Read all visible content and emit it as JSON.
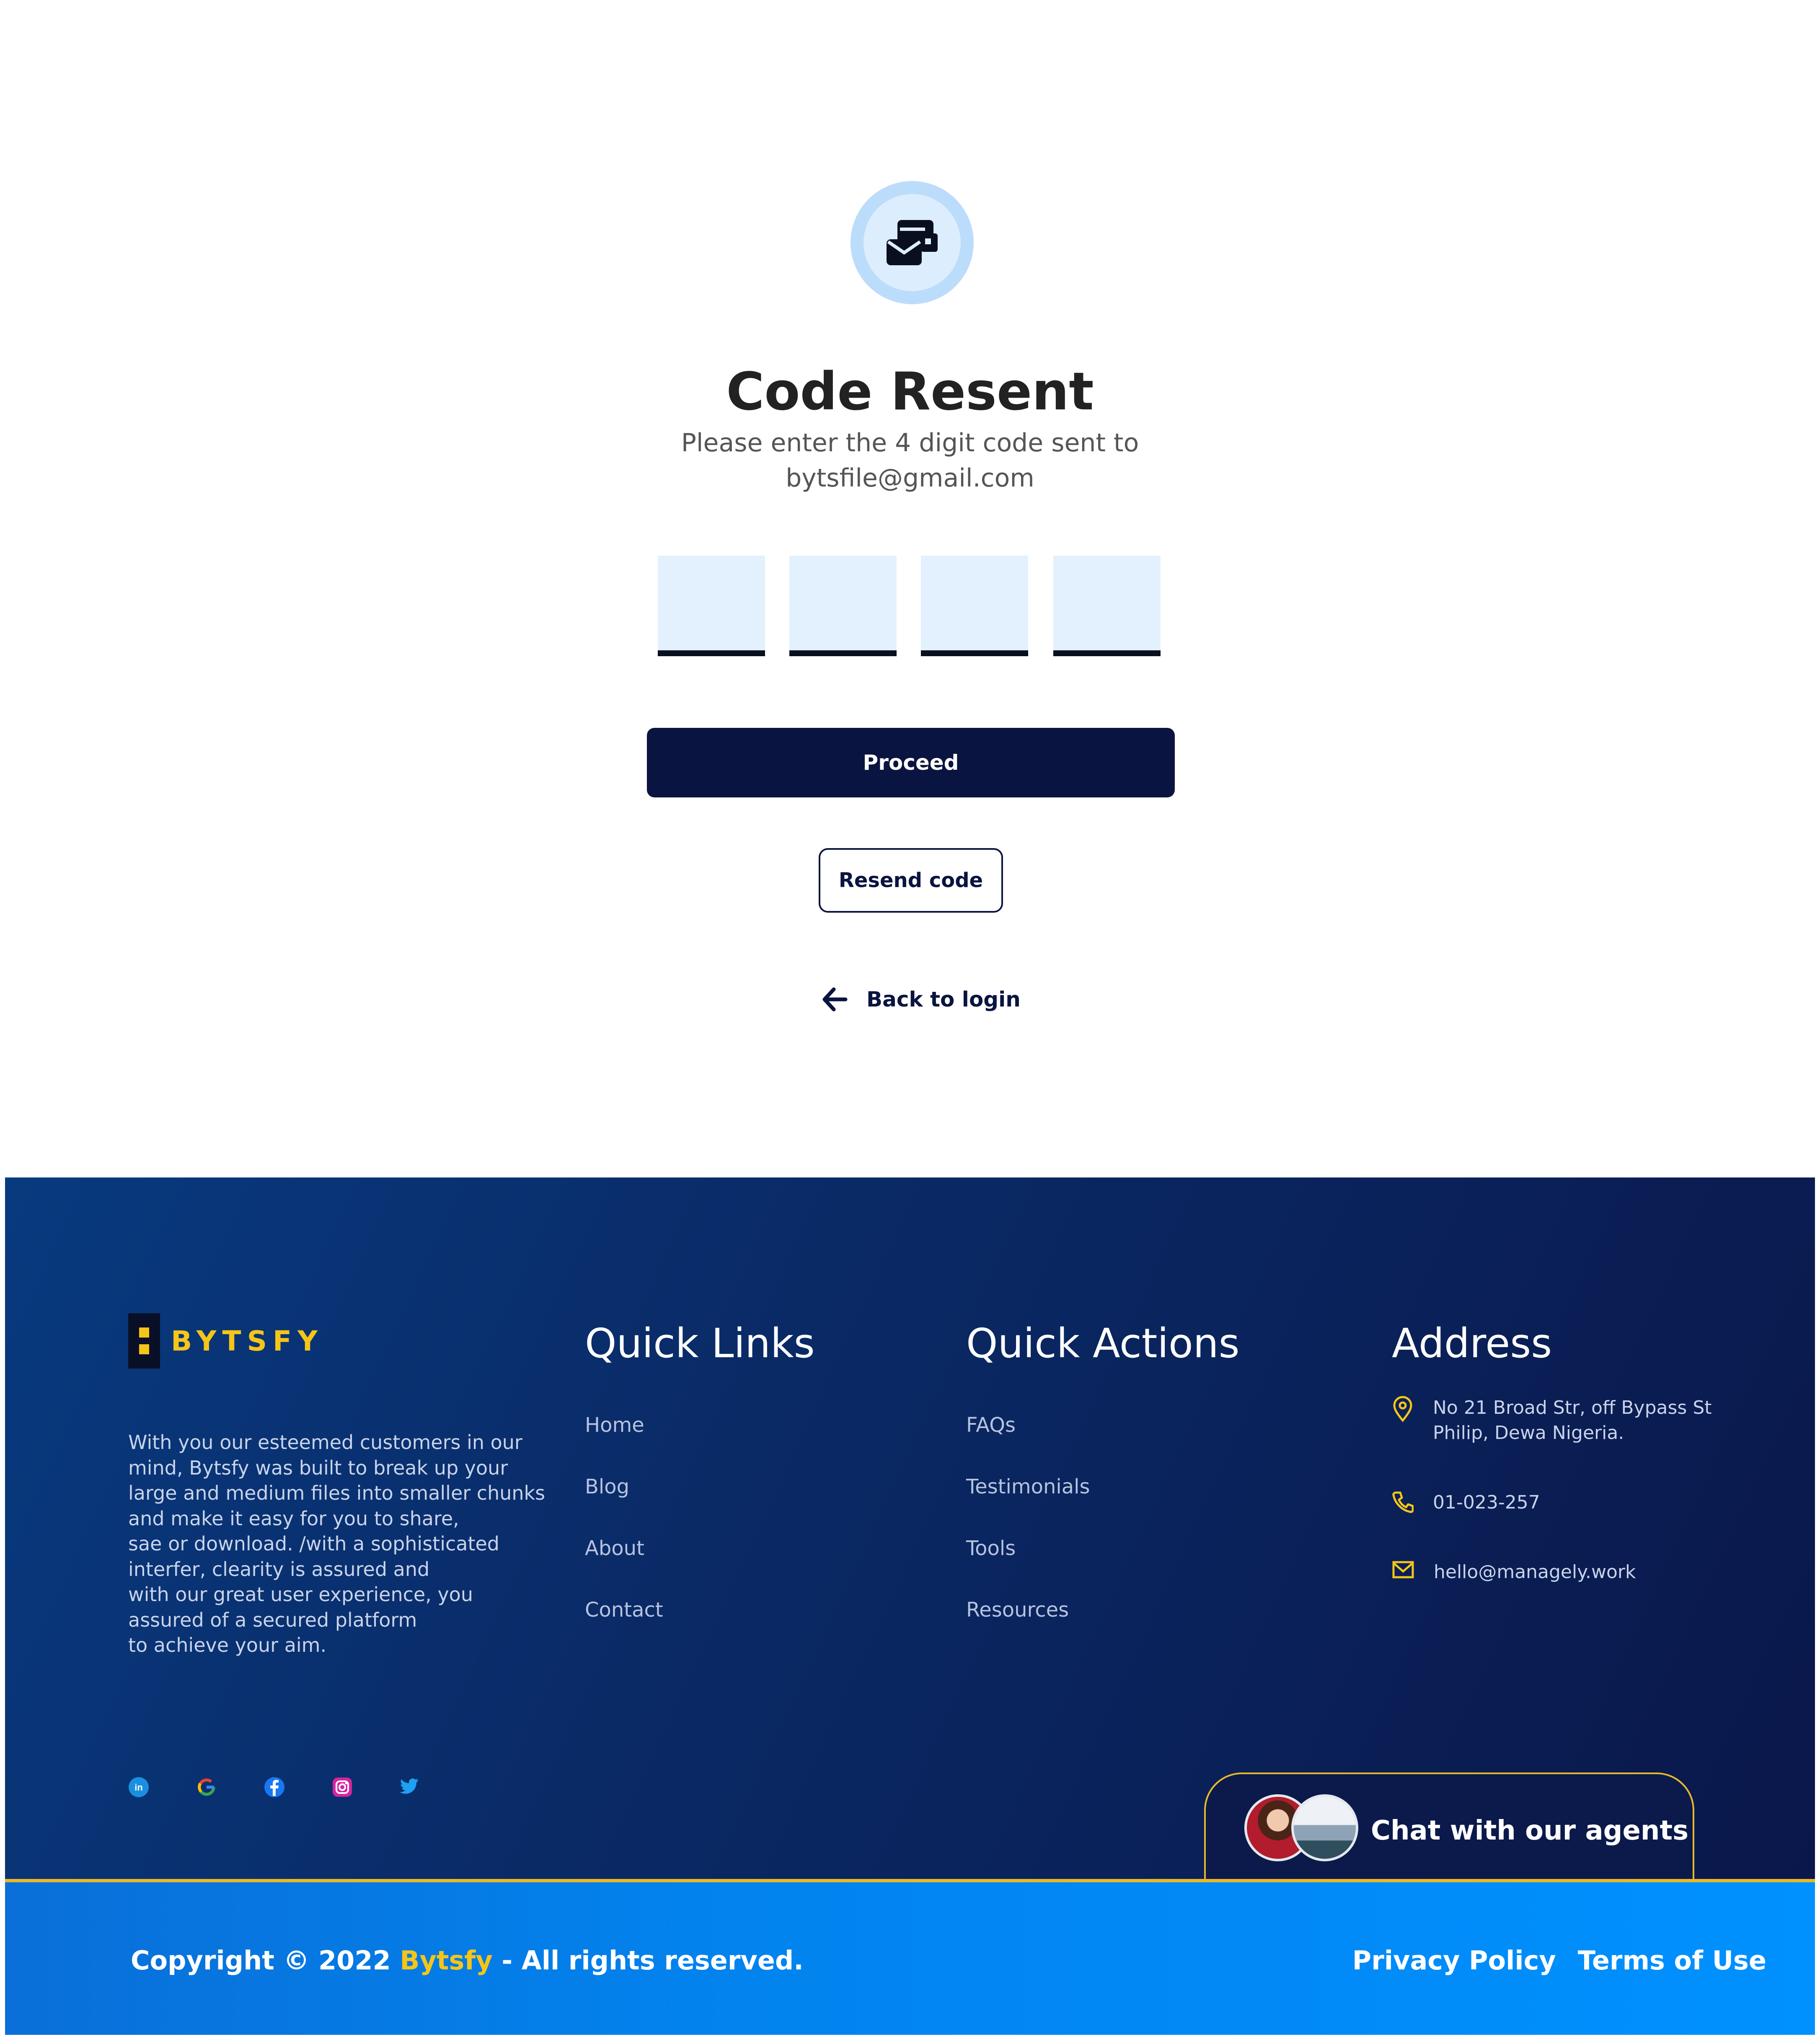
{
  "verify": {
    "title": "Code Resent",
    "subtitle_line1": "Please enter the 4 digit code sent to",
    "subtitle_line2": "bytsfile@gmail.com",
    "code_digits": [
      "",
      "",
      "",
      ""
    ],
    "proceed_label": "Proceed",
    "resend_label": "Resend code",
    "back_label": "Back to login",
    "icon": "mail-envelope-icon"
  },
  "footer": {
    "brand": "BYTSFY",
    "about_lines": [
      "With you our esteemed customers in our",
      "mind, Bytsfy was built to break up your",
      "large and medium files into smaller chunks",
      "and make it easy for you to share,",
      "sae or download. /with a sophisticated",
      "interfer, clearity is assured and",
      "with our great user experience, you",
      "assured of a secured platform",
      "to achieve your aim."
    ],
    "quick_links": {
      "heading": "Quick Links",
      "items": [
        "Home",
        "Blog",
        "About",
        "Contact"
      ]
    },
    "quick_actions": {
      "heading": "Quick Actions",
      "items": [
        "FAQs",
        "Testimonials",
        "Tools",
        "Resources"
      ]
    },
    "address": {
      "heading": "Address",
      "street_line1": "No 21 Broad Str, off Bypass St",
      "street_line2": "Philip, Dewa Nigeria.",
      "phone": "01-023-257",
      "email": "hello@managely.work"
    },
    "socials": [
      "linkedin-icon",
      "google-icon",
      "facebook-icon",
      "instagram-icon",
      "twitter-icon"
    ],
    "chat_label": "Chat with our agents",
    "copyright_prefix": "Copyright © 2022 ",
    "copyright_brand": "Bytsfy",
    "copyright_suffix": " - All rights reserved.",
    "privacy_label": "Privacy Policy",
    "terms_label": "Terms of Use"
  },
  "colors": {
    "navy": "#0a1440",
    "accent_yellow": "#f5c518",
    "code_box": "#e3f0fd",
    "bottom_bar_blue": "#0091ff"
  }
}
